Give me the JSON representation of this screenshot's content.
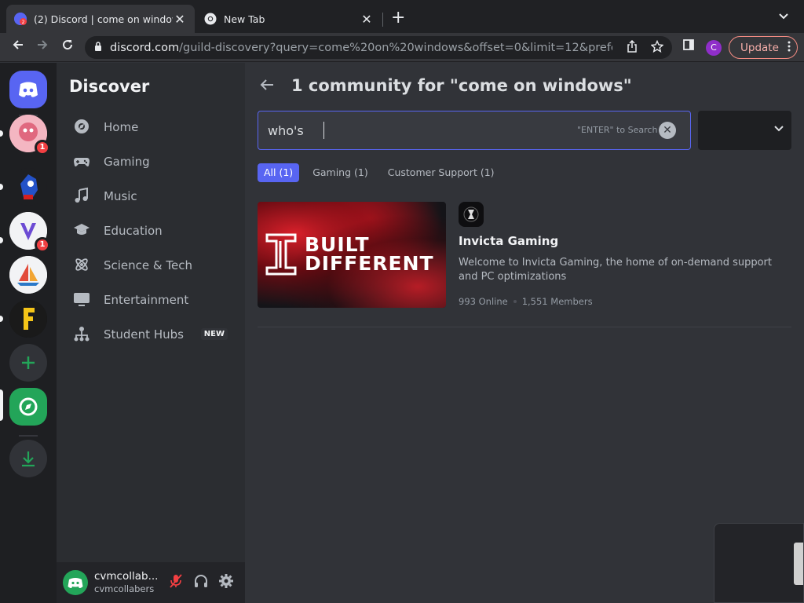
{
  "browser": {
    "tabs": [
      {
        "title": "(2) Discord | come on windows",
        "close": "✕",
        "active": true
      },
      {
        "title": "New Tab",
        "close": "✕",
        "active": false
      }
    ],
    "new_tab": "+",
    "url_host": "discord.com",
    "url_path": "/guild-discovery?query=come%20on%20windows&offset=0&limit=12&preferredLo...",
    "profile_initial": "C",
    "update_label": "Update"
  },
  "guilds": {
    "badges": [
      "1",
      "1"
    ]
  },
  "sidebar": {
    "title": "Discover",
    "categories": [
      {
        "label": "Home",
        "icon": "compass-icon"
      },
      {
        "label": "Gaming",
        "icon": "gamepad-icon"
      },
      {
        "label": "Music",
        "icon": "music-note-icon"
      },
      {
        "label": "Education",
        "icon": "graduation-cap-icon"
      },
      {
        "label": "Science & Tech",
        "icon": "atom-icon"
      },
      {
        "label": "Entertainment",
        "icon": "tv-icon"
      },
      {
        "label": "Student Hubs",
        "icon": "hub-icon",
        "tag": "NEW"
      }
    ]
  },
  "user": {
    "name": "cvmcollab...",
    "tag": "cvmcollabers"
  },
  "main": {
    "title": "1 community for \"come on windows\"",
    "search_value": "who's",
    "search_hint": "\"ENTER\" to Search",
    "filters": [
      "All (1)",
      "Gaming (1)",
      "Customer Support (1)"
    ],
    "result": {
      "banner_line1": "BUILT",
      "banner_line2": "DIFFERENT",
      "name": "Invicta Gaming",
      "description": "Welcome to Invicta Gaming, the home of on-demand support and PC optimizations",
      "online": "993 Online",
      "members": "1,551 Members"
    }
  },
  "colors": {
    "blurple": "#5865f2",
    "green": "#23a559",
    "red_badge": "#f23f42"
  }
}
